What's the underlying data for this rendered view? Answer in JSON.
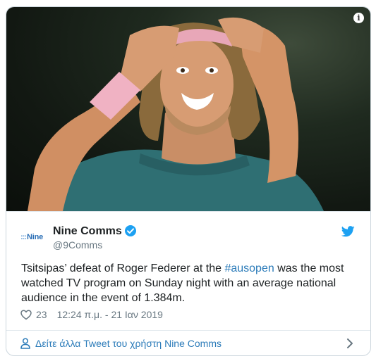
{
  "tweet": {
    "author_name": "Nine Comms",
    "author_handle": "@9Comms",
    "logo_text": "Nine",
    "text_before": "Tsitsipas’ defeat of Roger Federer at the ",
    "hashtag": "#ausopen",
    "text_after": " was the most watched TV program on Sunday night with an average national audience in the event of 1.384m.",
    "likes": "23",
    "timestamp": "12:24 π.μ. - 21 Ιαν 2019",
    "more_link": "Δείτε άλλα Tweet του χρήστη Nine Comms"
  },
  "colors": {
    "link": "#2b7bb9",
    "verified": "#1da1f2",
    "twitter_bird": "#1da1f2",
    "muted_text": "#697882",
    "logo_blue": "#2b6fb6"
  },
  "icons": [
    "info-icon",
    "verified-badge-icon",
    "twitter-bird-icon",
    "heart-icon",
    "user-icon",
    "chevron-right-icon"
  ]
}
